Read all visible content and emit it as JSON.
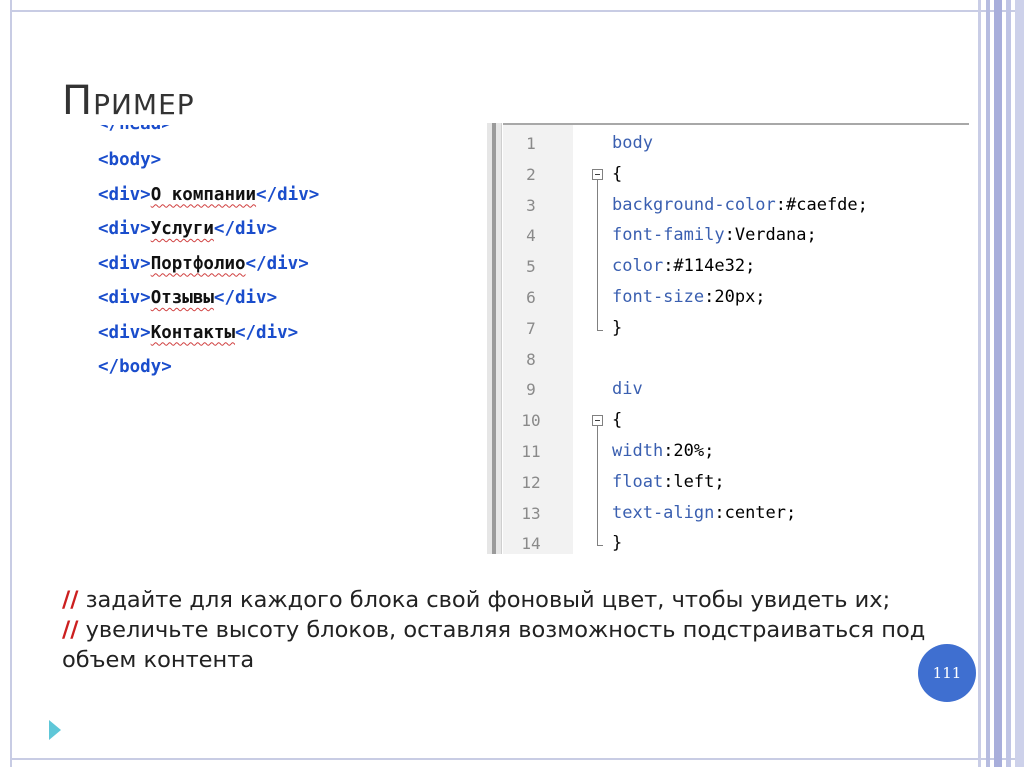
{
  "slide": {
    "title": "Пример",
    "page_number": "111",
    "accent_color": "#3f6fd0"
  },
  "html_example": {
    "lines": [
      {
        "tag_open": "<body>",
        "text": "",
        "tag_close": ""
      },
      {
        "tag_open": "<div>",
        "text": "О компании",
        "tag_close": "</div>"
      },
      {
        "tag_open": "<div>",
        "text": "Услуги",
        "tag_close": "</div>"
      },
      {
        "tag_open": "<div>",
        "text": "Портфолио",
        "tag_close": "</div>"
      },
      {
        "tag_open": "<div>",
        "text": "Отзывы",
        "tag_close": "</div>"
      },
      {
        "tag_open": "<div>",
        "text": "Контакты",
        "tag_close": "</div>"
      },
      {
        "tag_open": "</body>",
        "text": "",
        "tag_close": ""
      }
    ],
    "partial_top": "</head>"
  },
  "css_editor": {
    "lines": [
      {
        "n": "1",
        "prop": "body",
        "val": "",
        "fold": "none"
      },
      {
        "n": "2",
        "prop": "",
        "val": "{",
        "fold": "open"
      },
      {
        "n": "3",
        "prop": "background-color",
        "val": ":#caefde;",
        "fold": "line"
      },
      {
        "n": "4",
        "prop": "font-family",
        "val": ":Verdana;",
        "fold": "line"
      },
      {
        "n": "5",
        "prop": "color",
        "val": ":#114e32;",
        "fold": "line"
      },
      {
        "n": "6",
        "prop": "font-size",
        "val": ":20px;",
        "fold": "line"
      },
      {
        "n": "7",
        "prop": "",
        "val": "}",
        "fold": "end"
      },
      {
        "n": "8",
        "prop": "",
        "val": "",
        "fold": "none"
      },
      {
        "n": "9",
        "prop": "div",
        "val": "",
        "fold": "none"
      },
      {
        "n": "10",
        "prop": "",
        "val": "{",
        "fold": "open"
      },
      {
        "n": "11",
        "prop": "width",
        "val": ":20%;",
        "fold": "line"
      },
      {
        "n": "12",
        "prop": "float",
        "val": ":left;",
        "fold": "line"
      },
      {
        "n": "13",
        "prop": "text-align",
        "val": ":center;",
        "fold": "line"
      },
      {
        "n": "14",
        "prop": "",
        "val": "}",
        "fold": "end"
      }
    ]
  },
  "tasks": [
    {
      "marker": "//",
      "text": " задайте для каждого блока свой фоновый цвет, чтобы увидеть их;"
    },
    {
      "marker": "//",
      "text": " увеличьте высоту блоков, оставляя возможность подстраиваться под объем контента"
    }
  ],
  "icons": {
    "bullet": "triangle-arrow-icon"
  }
}
